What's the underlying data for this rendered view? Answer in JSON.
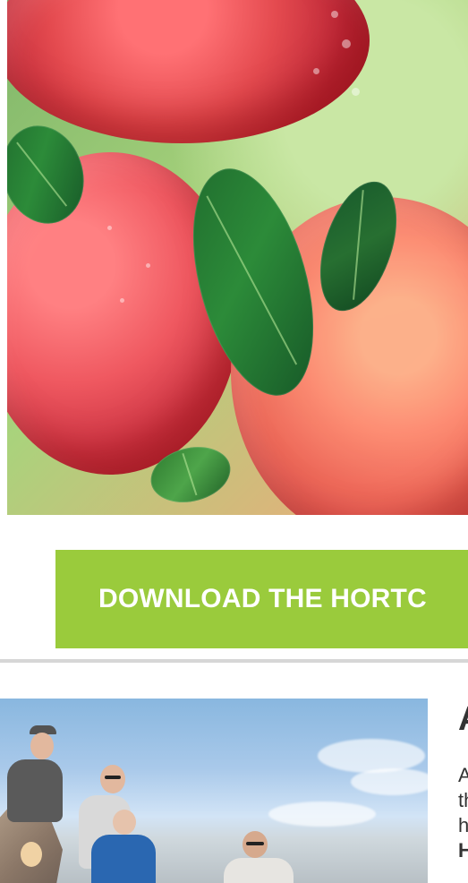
{
  "banner": {
    "label": "DOWNLOAD THE HORTC",
    "color": "#9acb3c",
    "text_color": "#ffffff"
  },
  "article": {
    "heading_partial": "A",
    "body_partial_lines": [
      "A",
      "th",
      "h",
      "H"
    ]
  }
}
